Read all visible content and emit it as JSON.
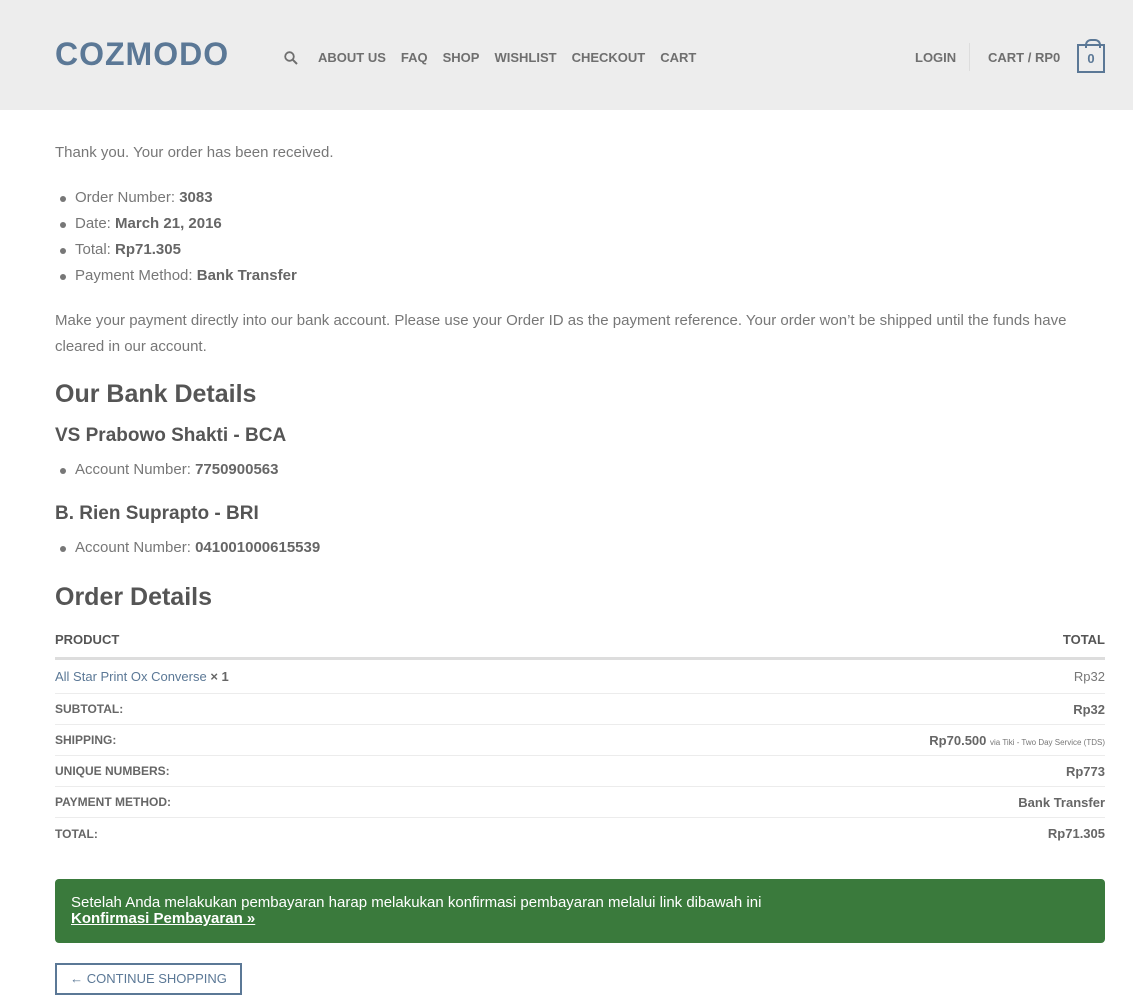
{
  "header": {
    "logo": "COZMODO",
    "nav": [
      "ABOUT US",
      "FAQ",
      "SHOP",
      "WISHLIST",
      "CHECKOUT",
      "CART"
    ],
    "login": "LOGIN",
    "cart_label": "CART / RP0",
    "cart_count": "0"
  },
  "order": {
    "thanks": "Thank you. Your order has been received.",
    "number_label": "Order Number:",
    "number": "3083",
    "date_label": "Date:",
    "date": "March 21, 2016",
    "total_label": "Total:",
    "total": "Rp71.305",
    "method_label": "Payment Method:",
    "method": "Bank Transfer",
    "instructions": "Make your payment directly into our bank account. Please use your Order ID as the payment reference. Your order won’t be shipped until the funds have cleared in our account."
  },
  "bank": {
    "heading": "Our Bank Details",
    "accounts": [
      {
        "name": "VS Prabowo Shakti - BCA",
        "label": "Account Number:",
        "number": "7750900563"
      },
      {
        "name": "B. Rien Suprapto - BRI",
        "label": "Account Number:",
        "number": "041001000615539"
      }
    ]
  },
  "details": {
    "heading": "Order Details",
    "col_product": "PRODUCT",
    "col_total": "TOTAL",
    "product_name": "All Star Print Ox Converse",
    "product_qty": "× 1",
    "product_total": "Rp32",
    "subtotal_label": "SUBTOTAL:",
    "subtotal": "Rp32",
    "shipping_label": "SHIPPING:",
    "shipping": "Rp70.500",
    "shipping_via": "via Tiki - Two Day Service (TDS)",
    "unique_label": "UNIQUE NUMBERS:",
    "unique": "Rp773",
    "method_label": "PAYMENT METHOD:",
    "method": "Bank Transfer",
    "total_label": "TOTAL:",
    "total": "Rp71.305"
  },
  "notice": {
    "text": "Setelah Anda melakukan pembayaran harap melakukan konfirmasi pembayaran melalui link dibawah ini",
    "link": "Konfirmasi Pembayaran »"
  },
  "continue_button": "← CONTINUE SHOPPING"
}
